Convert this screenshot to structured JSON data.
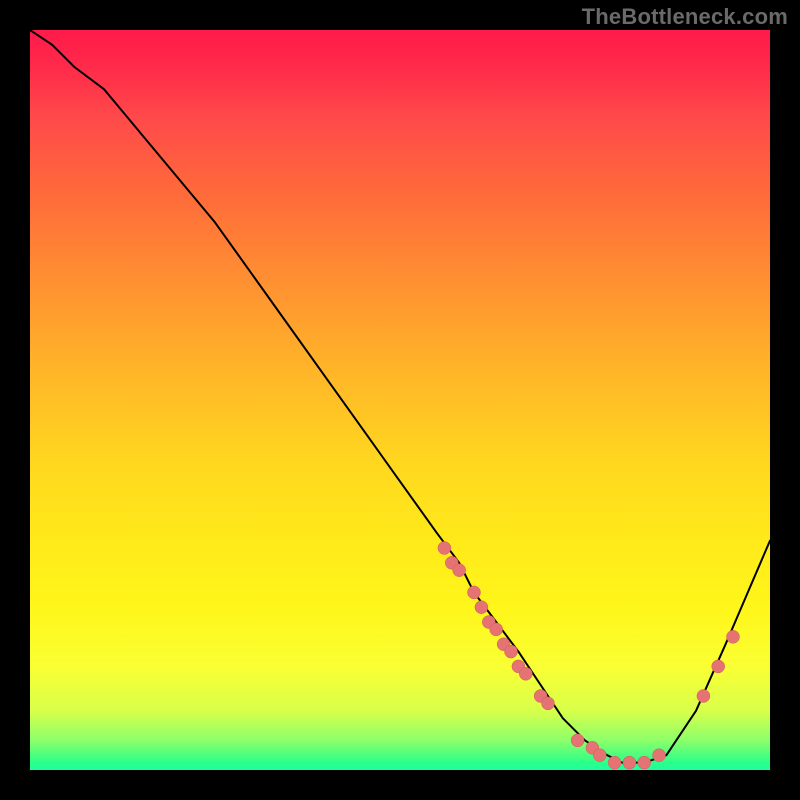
{
  "watermark": "TheBottleneck.com",
  "chart_data": {
    "type": "line",
    "title": "",
    "xlabel": "",
    "ylabel": "",
    "xlim": [
      0,
      100
    ],
    "ylim": [
      0,
      100
    ],
    "grid": false,
    "legend": false,
    "series": [
      {
        "name": "curve",
        "x": [
          0,
          3,
          6,
          10,
          15,
          20,
          25,
          30,
          35,
          40,
          45,
          50,
          55,
          58,
          60,
          63,
          66,
          70,
          72,
          75,
          78,
          80,
          83,
          86,
          90,
          94,
          97,
          100
        ],
        "y": [
          100,
          98,
          95,
          92,
          86,
          80,
          74,
          67,
          60,
          53,
          46,
          39,
          32,
          28,
          24,
          20,
          16,
          10,
          7,
          4,
          2,
          1,
          1,
          2,
          8,
          17,
          24,
          31
        ]
      }
    ],
    "points": [
      {
        "name": "cluster-left",
        "x": 56,
        "y": 30
      },
      {
        "name": "cluster-left",
        "x": 57,
        "y": 28
      },
      {
        "name": "cluster-left",
        "x": 58,
        "y": 27
      },
      {
        "name": "cluster-left",
        "x": 60,
        "y": 24
      },
      {
        "name": "cluster-left",
        "x": 61,
        "y": 22
      },
      {
        "name": "cluster-left",
        "x": 62,
        "y": 20
      },
      {
        "name": "cluster-left",
        "x": 63,
        "y": 19
      },
      {
        "name": "cluster-left",
        "x": 64,
        "y": 17
      },
      {
        "name": "cluster-left",
        "x": 65,
        "y": 16
      },
      {
        "name": "cluster-left",
        "x": 66,
        "y": 14
      },
      {
        "name": "cluster-left",
        "x": 67,
        "y": 13
      },
      {
        "name": "cluster-left",
        "x": 69,
        "y": 10
      },
      {
        "name": "cluster-left",
        "x": 70,
        "y": 9
      },
      {
        "name": "cluster-bottom",
        "x": 74,
        "y": 4
      },
      {
        "name": "cluster-bottom",
        "x": 76,
        "y": 3
      },
      {
        "name": "cluster-bottom",
        "x": 77,
        "y": 2
      },
      {
        "name": "cluster-bottom",
        "x": 79,
        "y": 1
      },
      {
        "name": "cluster-bottom",
        "x": 81,
        "y": 1
      },
      {
        "name": "cluster-bottom",
        "x": 83,
        "y": 1
      },
      {
        "name": "cluster-bottom",
        "x": 85,
        "y": 2
      },
      {
        "name": "cluster-right",
        "x": 91,
        "y": 10
      },
      {
        "name": "cluster-right",
        "x": 93,
        "y": 14
      },
      {
        "name": "cluster-right",
        "x": 95,
        "y": 18
      }
    ],
    "gradient_colors": {
      "top": "#ff1a4a",
      "middle": "#ffd61f",
      "bottom": "#1effa0"
    }
  }
}
